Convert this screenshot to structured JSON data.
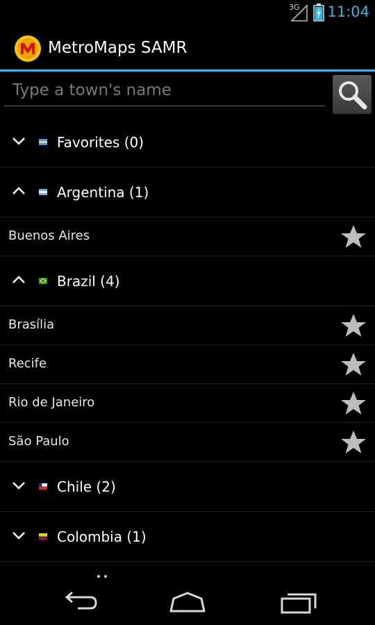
{
  "status_bar": {
    "network": "3G",
    "time": "11:04",
    "accent_color": "#33b5e5"
  },
  "action_bar": {
    "title": "MetroMaps SAMR",
    "logo_icon": "metromaps-logo-icon"
  },
  "search": {
    "placeholder": "Type a town's name",
    "value": "",
    "button_icon": "magnifier-icon"
  },
  "groups": [
    {
      "label": "Favorites (0)",
      "expanded": false,
      "flag": "favorites-flag-icon",
      "children": []
    },
    {
      "label": "Argentina (1)",
      "expanded": true,
      "flag": "argentina-flag-icon",
      "children": [
        {
          "label": "Buenos Aires"
        }
      ]
    },
    {
      "label": "Brazil (4)",
      "expanded": true,
      "flag": "brazil-flag-icon",
      "children": [
        {
          "label": "Brasília"
        },
        {
          "label": "Recife"
        },
        {
          "label": "Rio de Janeiro"
        },
        {
          "label": "São Paulo"
        }
      ]
    },
    {
      "label": "Chile (2)",
      "expanded": false,
      "flag": "chile-flag-icon",
      "children": []
    },
    {
      "label": "Colombia (1)",
      "expanded": false,
      "flag": "colombia-flag-icon",
      "children": []
    }
  ],
  "nav_bar": {
    "back_icon": "back-icon",
    "home_icon": "home-icon",
    "recents_icon": "recent-apps-icon"
  }
}
